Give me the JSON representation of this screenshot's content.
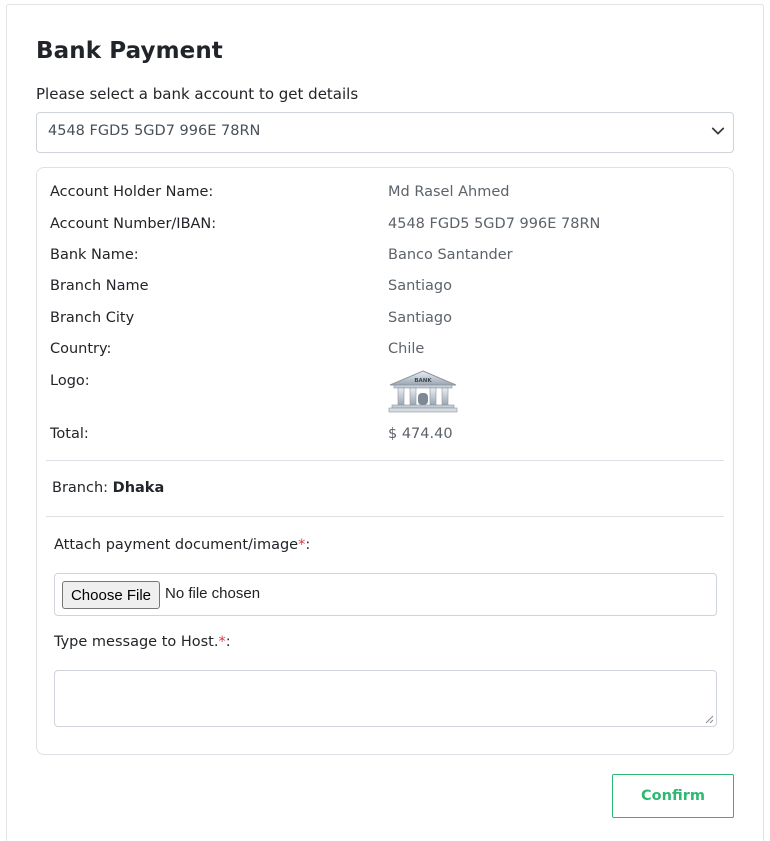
{
  "page": {
    "title": "Bank Payment",
    "select_label": "Please select a bank account to get details"
  },
  "bank_select": {
    "selected": "4548 FGD5 5GD7 996E 78RN",
    "icon": "chevron-down-icon"
  },
  "details": {
    "rows": [
      {
        "key": "Account Holder Name:",
        "value": "Md Rasel Ahmed"
      },
      {
        "key": "Account Number/IBAN:",
        "value": "4548 FGD5 5GD7 996E 78RN"
      },
      {
        "key": "Bank Name:",
        "value": "Banco Santander"
      },
      {
        "key": "Branch Name",
        "value": "Santiago"
      },
      {
        "key": "Branch City",
        "value": "Santiago"
      },
      {
        "key": "Country:",
        "value": "Chile"
      },
      {
        "key": "Logo:",
        "value": ""
      },
      {
        "key": "Total:",
        "value": "$ 474.40"
      }
    ],
    "logo_text": "BANK"
  },
  "branch": {
    "label": "Branch:",
    "name": "Dhaka"
  },
  "attachment": {
    "label": "Attach payment document/image",
    "required_mark": "*",
    "suffix": ":",
    "button_label": "Choose File",
    "status": "No file chosen"
  },
  "message": {
    "label": "Type message to Host.",
    "required_mark": "*",
    "suffix": ":",
    "value": ""
  },
  "actions": {
    "confirm_label": "Confirm"
  },
  "colors": {
    "accent": "#2eb872",
    "required": "#dc3545",
    "border": "#dee2e6"
  }
}
